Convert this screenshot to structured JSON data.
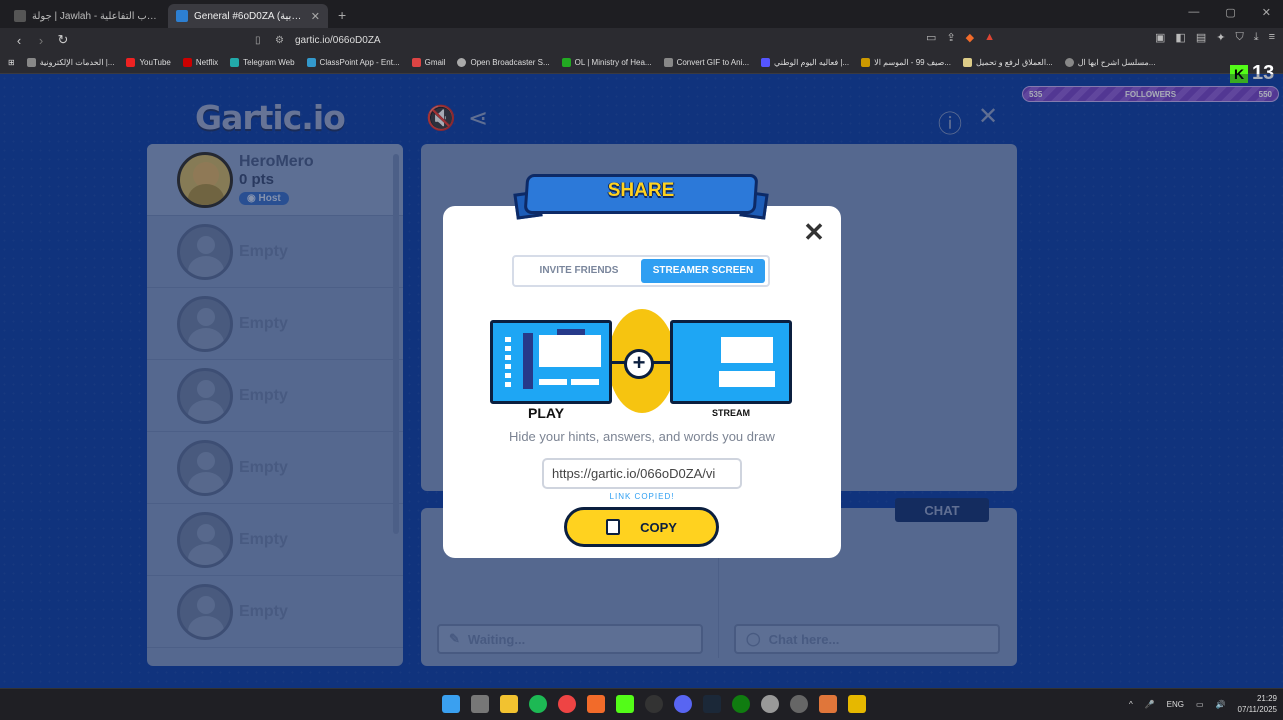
{
  "browser": {
    "tabs": [
      {
        "title": "جولة | Jawlah - منصة الألعاب التفاعلية",
        "active": false
      },
      {
        "title": "General #6oD0ZA (العربية) - Gartic",
        "active": true
      }
    ],
    "url": "gartic.io/066oD0ZA",
    "bookmarks": [
      "الخدمات الإلكترونية |...",
      "YouTube",
      "Netflix",
      "Telegram Web",
      "ClassPoint App - Ent...",
      "Gmail",
      "Open Broadcaster S...",
      "OL | Ministry of Hea...",
      "Convert GIF to Ani...",
      "فعاليه اليوم الوطني |...",
      "صيف 99 - الموسم الا...",
      "العملاق لرفع و تحميل...",
      "مسلسل اشرح ايها ال..."
    ]
  },
  "stream_overlay": {
    "kick_count": "13",
    "followers_label": "FOLLOWERS",
    "followers_current": "535",
    "followers_goal": "550",
    "followers_fraction": 0.0
  },
  "game": {
    "logo_text": "Gartic.io",
    "players": [
      {
        "name": "HeroMero",
        "points": "0 pts",
        "badge": "Host"
      },
      {
        "empty_label": "Empty"
      },
      {
        "empty_label": "Empty"
      },
      {
        "empty_label": "Empty"
      },
      {
        "empty_label": "Empty"
      },
      {
        "empty_label": "Empty"
      },
      {
        "empty_label": "Empty"
      }
    ],
    "chat_tab": "CHAT",
    "answer_placeholder": "Waiting...",
    "chat_placeholder": "Chat here..."
  },
  "modal": {
    "title": "SHARE",
    "tab_invite": "INVITE FRIENDS",
    "tab_streamer": "STREAMER SCREEN",
    "label_play": "PLAY",
    "label_stream": "STREAM",
    "description": "Hide your hints, answers, and words you draw",
    "link": "https://gartic.io/066oD0ZA/vi",
    "link_status": "LINK COPIED!",
    "copy_label": "COPY"
  },
  "taskbar": {
    "language": "ENG",
    "time": "21:29",
    "date": "07/11/2025"
  },
  "colors": {
    "game_bg": "#1444a6",
    "accent_blue": "#2f9ff2",
    "copy_yellow": "#ffd21f",
    "followers_purple": "#7a4bc8"
  }
}
